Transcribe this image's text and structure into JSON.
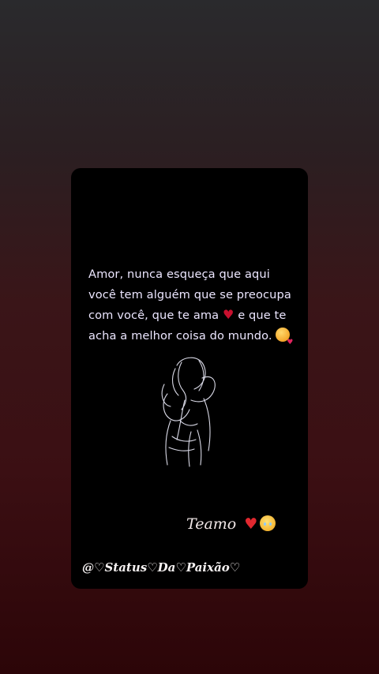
{
  "story": {
    "quote_lines": [
      "Amor, nunca esqueça que aqui",
      "você tem alguém que se preocupa",
      "com você, que te ama",
      "e que te",
      "acha a melhor coisa do mundo."
    ],
    "signature": "Teamo",
    "handle": "@♡Status♡Da♡Paixão♡"
  },
  "icons": {
    "heart": "red-heart-icon",
    "smiling_face_with_hearts": "smiling-face-with-hearts-icon",
    "pleading_face": "pleading-face-icon",
    "couple_illustration": "couple-hug-line-art"
  },
  "colors": {
    "card_background": "#000000",
    "text": "#ece6ff",
    "heart": "#e2282f"
  }
}
